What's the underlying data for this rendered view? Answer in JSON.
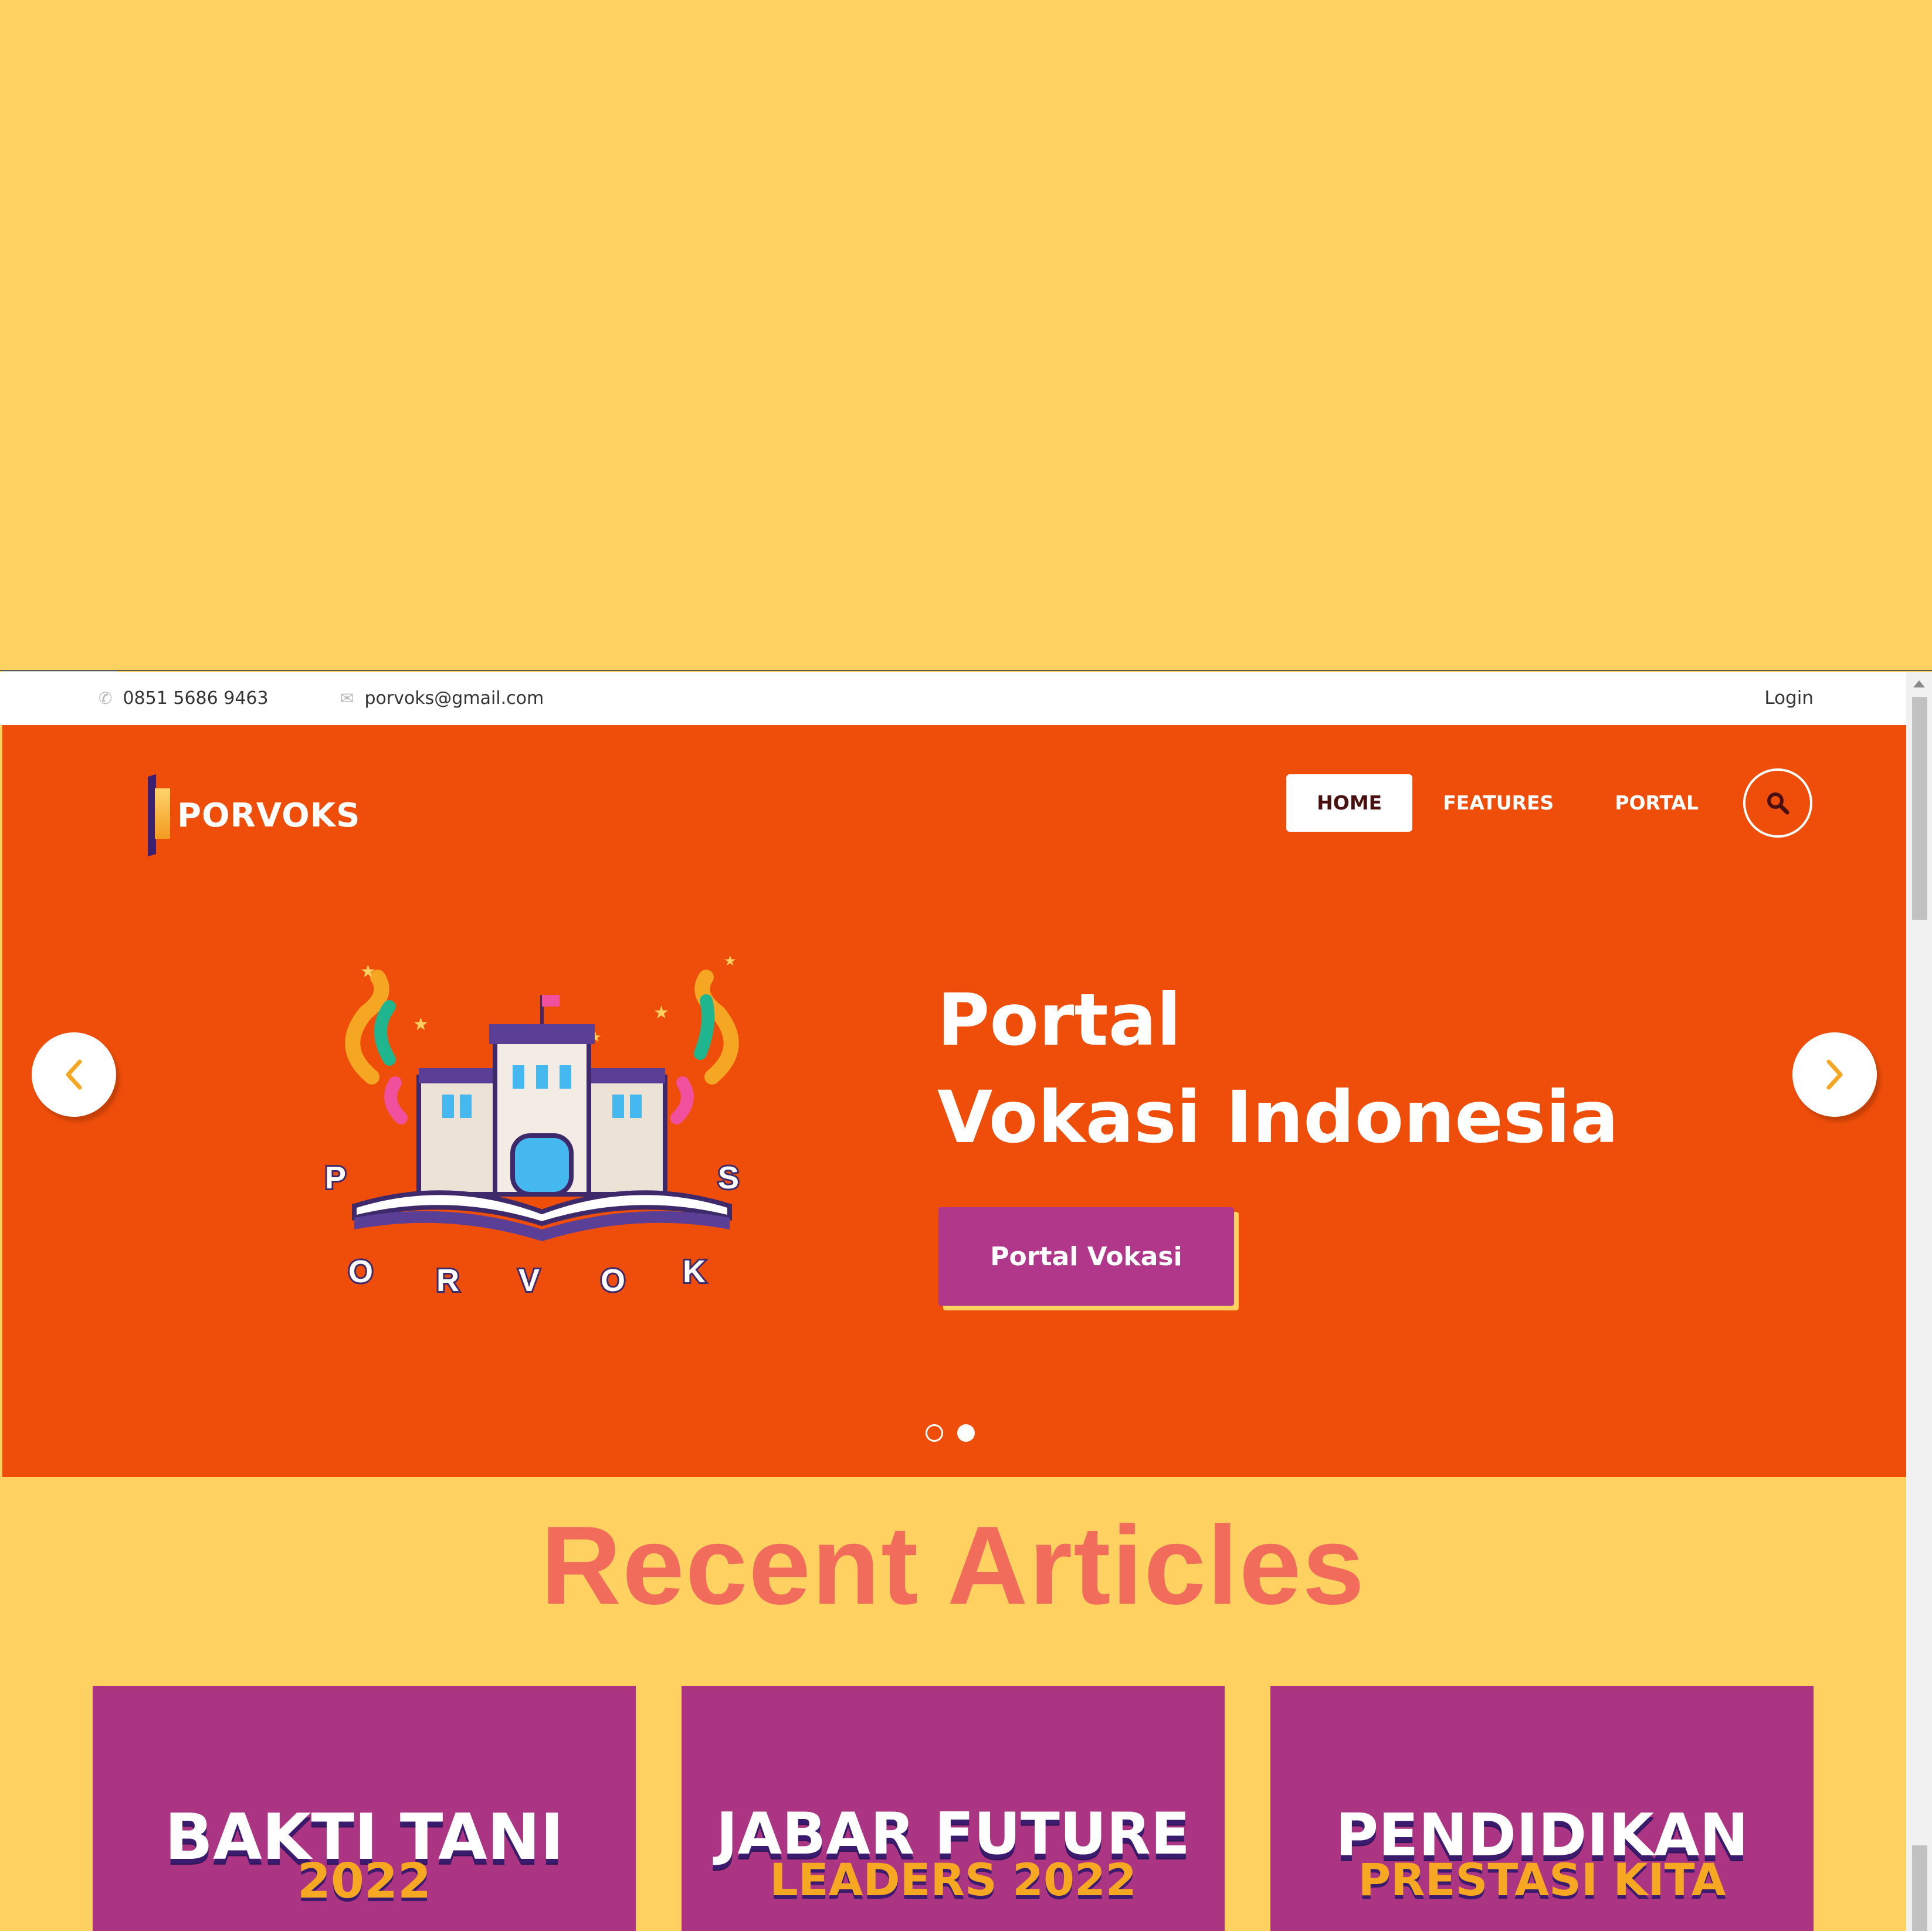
{
  "contact": {
    "phone": "0851 5686 9463",
    "email": "porvoks@gmail.com",
    "login": "Login"
  },
  "header": {
    "brand": "PORVOKS",
    "nav": [
      "HOME",
      "FEATURES",
      "PORTAL"
    ]
  },
  "hero": {
    "title_line1": "Portal",
    "title_line2": "Vokasi Indonesia",
    "cta_label": "Portal Vokasi",
    "illustration_letters": [
      "P",
      "O",
      "R",
      "V",
      "O",
      "K",
      "S"
    ],
    "active_slide": 2,
    "total_slides": 2
  },
  "articles": {
    "heading": "Recent Articles",
    "cards": [
      {
        "line1": "BAKTI TANI",
        "line2": "2022"
      },
      {
        "line1": "JABAR FUTURE",
        "line2": "LEADERS 2022"
      },
      {
        "line1": "PENDIDIKAN",
        "line2": "PRESTASI KITA"
      }
    ]
  },
  "colors": {
    "page_background": "#ffd161",
    "hero": "#ee4e0a",
    "cta": "#b0378a",
    "card": "#ab3583",
    "heading": "#f26c5b",
    "arrow_icon": "#f5a623"
  },
  "icons": [
    "phone-icon",
    "mail-icon",
    "search-icon",
    "chevron-left-icon",
    "chevron-right-icon"
  ]
}
